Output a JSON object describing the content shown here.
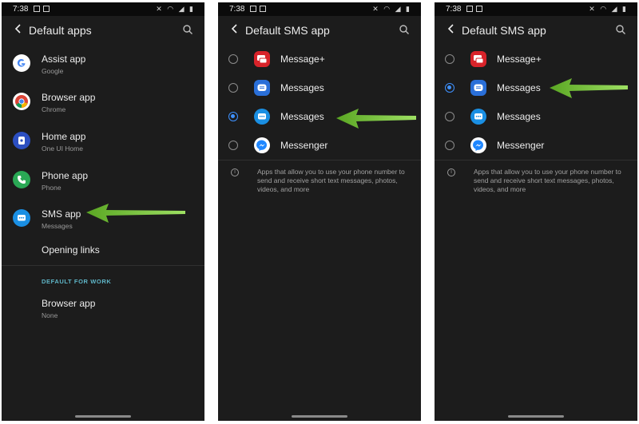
{
  "status_time": "7:38",
  "colors": {
    "background": "#1c1c1c",
    "accent_radio": "#3e91ff",
    "section_label": "#5fb6c8",
    "arrow": "#6ab82d"
  },
  "screen1": {
    "title": "Default apps",
    "items": [
      {
        "label": "Assist app",
        "sub": "Google",
        "icon": "google-icon"
      },
      {
        "label": "Browser app",
        "sub": "Chrome",
        "icon": "chrome-icon"
      },
      {
        "label": "Home app",
        "sub": "One UI Home",
        "icon": "home-icon"
      },
      {
        "label": "Phone app",
        "sub": "Phone",
        "icon": "phone-icon"
      },
      {
        "label": "SMS app",
        "sub": "Messages",
        "icon": "messages-icon"
      },
      {
        "label": "Opening links",
        "sub": "",
        "icon": ""
      }
    ],
    "section": "DEFAULT FOR WORK",
    "work_item": {
      "label": "Browser app",
      "sub": "None"
    }
  },
  "screen2": {
    "title": "Default SMS app",
    "options": [
      {
        "label": "Message+",
        "checked": false,
        "icon": "message-plus-icon"
      },
      {
        "label": "Messages",
        "checked": false,
        "icon": "samsung-messages-icon"
      },
      {
        "label": "Messages",
        "checked": true,
        "icon": "google-messages-icon"
      },
      {
        "label": "Messenger",
        "checked": false,
        "icon": "messenger-icon"
      }
    ],
    "info": "Apps that allow you to use your phone number to send and receive short text messages, photos, videos, and more"
  },
  "screen3": {
    "title": "Default SMS app",
    "options": [
      {
        "label": "Message+",
        "checked": false,
        "icon": "message-plus-icon"
      },
      {
        "label": "Messages",
        "checked": true,
        "icon": "samsung-messages-icon"
      },
      {
        "label": "Messages",
        "checked": false,
        "icon": "google-messages-icon"
      },
      {
        "label": "Messenger",
        "checked": false,
        "icon": "messenger-icon"
      }
    ],
    "info": "Apps that allow you to use your phone number to send and receive short text messages, photos, videos, and more"
  }
}
